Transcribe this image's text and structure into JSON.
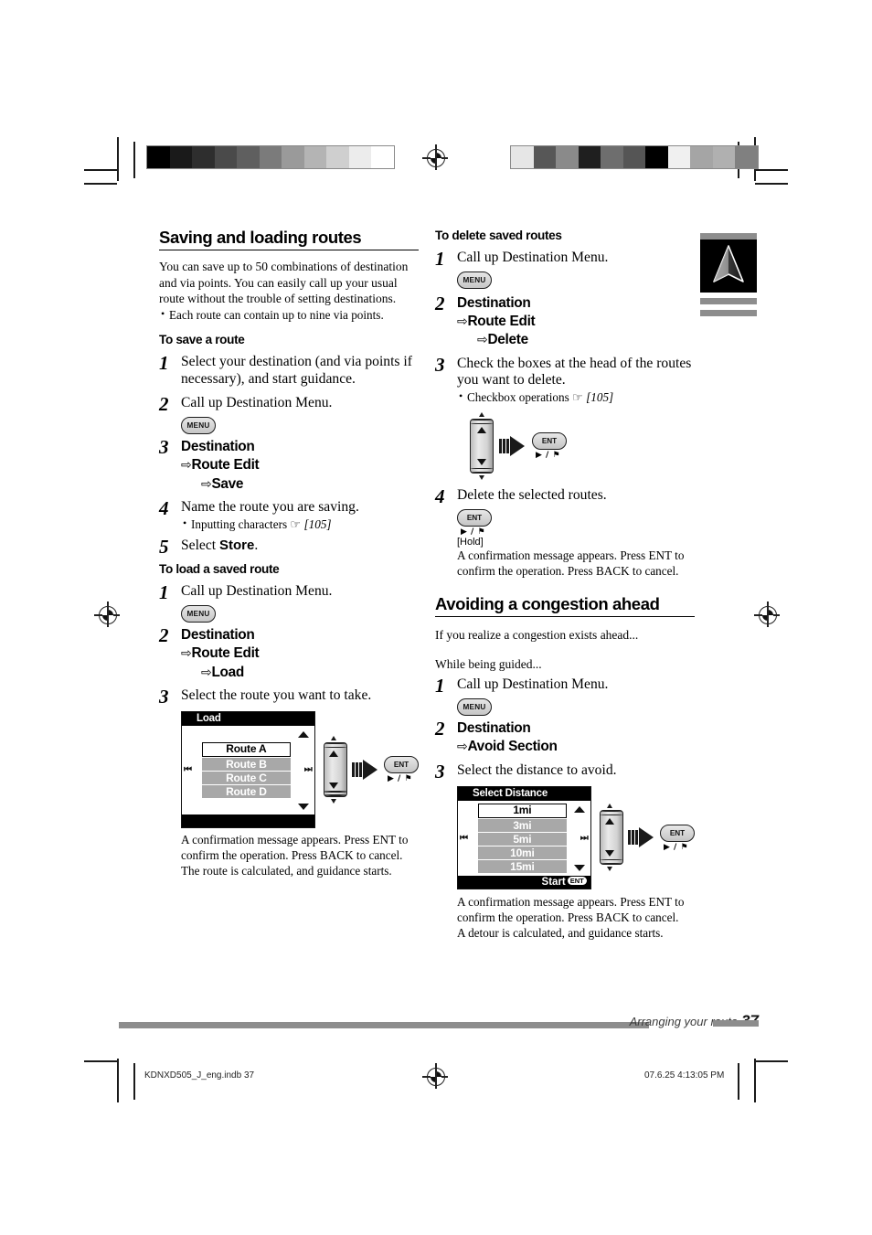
{
  "print_marks": {
    "calibration_left": [
      "#000000",
      "#1a1a1a",
      "#2e2e2e",
      "#4a4a4a",
      "#5f5f5f",
      "#7b7b7b",
      "#9a9a9a",
      "#b4b4b4",
      "#cfcfcf",
      "#ececec",
      "#ffffff"
    ],
    "calibration_right": [
      "#e6e6e6",
      "#575757",
      "#8a8a8a",
      "#1f1f1f",
      "#6e6e6e",
      "#555555",
      "#000000",
      "#f0f0f0",
      "#a5a5a5",
      "#b0b0b0",
      "#808080"
    ]
  },
  "nav_icon": {
    "name": "navigation-arrow-icon"
  },
  "left_column": {
    "heading": "Saving and loading routes",
    "intro": "You can save up to 50 combinations of destination and via points. You can easily call up your usual route without the trouble of setting destinations.",
    "intro_bullet": "Each route can contain up to nine via points.",
    "save_subhead": "To save a route",
    "save_steps": [
      {
        "num": "1",
        "text": "Select your destination (and via points if necessary), and start guidance."
      },
      {
        "num": "2",
        "text": "Call up Destination Menu.",
        "button": "MENU"
      },
      {
        "num": "3",
        "path": [
          "Destination",
          "Route Edit",
          "Save"
        ]
      },
      {
        "num": "4",
        "text": "Name the route you are saving.",
        "bullet": "Inputting characters",
        "bullet_ref": "[105]"
      },
      {
        "num": "5",
        "text_pre": "Select ",
        "text_kw": "Store",
        "text_post": "."
      }
    ],
    "load_subhead": "To load a saved route",
    "load_steps": [
      {
        "num": "1",
        "text": "Call up Destination Menu.",
        "button": "MENU"
      },
      {
        "num": "2",
        "path": [
          "Destination",
          "Route Edit",
          "Load"
        ]
      },
      {
        "num": "3",
        "text": "Select the route you want to take."
      }
    ],
    "load_widget": {
      "title": "Load",
      "rows": [
        "Route A",
        "Route B",
        "Route C",
        "Route D"
      ],
      "selected_index": 0,
      "prev_icon": "skip-previous-icon",
      "next_icon": "skip-next-icon",
      "scroll_up_icon": "scroll-up-icon",
      "scroll_down_icon": "scroll-down-icon"
    },
    "load_ent_button": "ENT",
    "load_ent_sub": "▶ / ⚑",
    "load_note": "A confirmation message appears. Press ENT to confirm the operation. Press BACK to cancel.",
    "load_note2": "The route is calculated, and guidance starts."
  },
  "right_column": {
    "delete_subhead": "To delete saved routes",
    "delete_steps": [
      {
        "num": "1",
        "text": "Call up Destination Menu.",
        "button": "MENU"
      },
      {
        "num": "2",
        "path": [
          "Destination",
          "Route Edit",
          "Delete"
        ]
      },
      {
        "num": "3",
        "text": "Check the boxes at the head of the routes you want to delete.",
        "bullet": "Checkbox operations",
        "bullet_ref": "[105]"
      },
      {
        "num": "4",
        "text": "Delete the selected routes."
      }
    ],
    "delete_ent_button": "ENT",
    "delete_ent_sub": "▶ / ⚑",
    "hold_label": "[Hold]",
    "delete_note": "A confirmation message appears. Press ENT to confirm the operation. Press BACK to cancel.",
    "congestion_heading": "Avoiding a congestion ahead",
    "congestion_intro": "If you realize a congestion exists ahead...",
    "congestion_guided": "While being guided...",
    "congestion_steps": [
      {
        "num": "1",
        "text": "Call up Destination Menu.",
        "button": "MENU"
      },
      {
        "num": "2",
        "path": [
          "Destination",
          "Avoid Section"
        ]
      },
      {
        "num": "3",
        "text": "Select the distance to avoid."
      }
    ],
    "distance_widget": {
      "title": "Select Distance",
      "rows": [
        "1mi",
        "3mi",
        "5mi",
        "10mi",
        "15mi"
      ],
      "selected_index": 0,
      "footer_label": "Start",
      "footer_badge": "ENT",
      "prev_icon": "skip-previous-icon",
      "next_icon": "skip-next-icon"
    },
    "distance_ent_button": "ENT",
    "distance_ent_sub": "▶ / ⚑",
    "congestion_note": "A confirmation message appears. Press ENT to confirm the operation. Press BACK to cancel.",
    "congestion_note2": "A detour is calculated, and guidance starts."
  },
  "footer": {
    "running_head": "Arranging your route",
    "page_number": "37",
    "print_file": "KDNXD505_J_eng.indb   37",
    "print_timestamp": "07.6.25   4:13:05 PM"
  }
}
